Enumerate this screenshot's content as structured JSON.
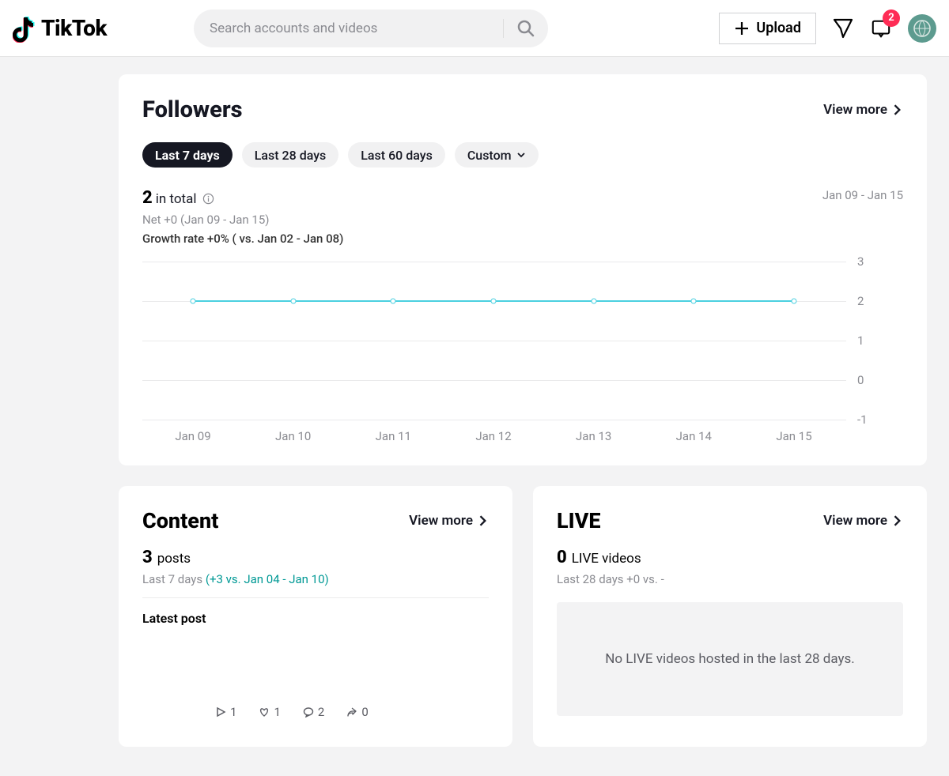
{
  "header": {
    "brand": "TikTok",
    "search_placeholder": "Search accounts and videos",
    "upload_label": "Upload",
    "notif_count": "2"
  },
  "followers": {
    "title": "Followers",
    "view_more": "View more",
    "filters": {
      "d7": "Last 7 days",
      "d28": "Last 28 days",
      "d60": "Last 60 days",
      "custom": "Custom"
    },
    "total_num": "2",
    "total_label": "in total",
    "date_range": "Jan 09 - Jan 15",
    "net": "Net +0 (Jan 09 - Jan 15)",
    "growth": "Growth rate +0% ( vs. Jan 02 - Jan 08)"
  },
  "content": {
    "title": "Content",
    "view_more": "View more",
    "posts_num": "3",
    "posts_label": "posts",
    "range_label": "Last 7 days",
    "delta": "(+3 vs. Jan 04 - Jan 10)",
    "latest_label": "Latest post",
    "stats": {
      "plays": "1",
      "likes": "1",
      "comments": "2",
      "shares": "0"
    }
  },
  "live": {
    "title": "LIVE",
    "view_more": "View more",
    "count_num": "0",
    "count_label": "LIVE videos",
    "range": "Last 28 days  +0 vs. -",
    "empty": "No LIVE videos hosted in the last 28 days."
  },
  "chart_data": {
    "type": "line",
    "title": "Followers",
    "xlabel": "",
    "ylabel": "",
    "ylim": [
      -1,
      3
    ],
    "y_ticks": [
      "3",
      "2",
      "1",
      "0",
      "-1"
    ],
    "categories": [
      "Jan 09",
      "Jan 10",
      "Jan 11",
      "Jan 12",
      "Jan 13",
      "Jan 14",
      "Jan 15"
    ],
    "series": [
      {
        "name": "Followers",
        "values": [
          2,
          2,
          2,
          2,
          2,
          2,
          2
        ]
      }
    ]
  }
}
